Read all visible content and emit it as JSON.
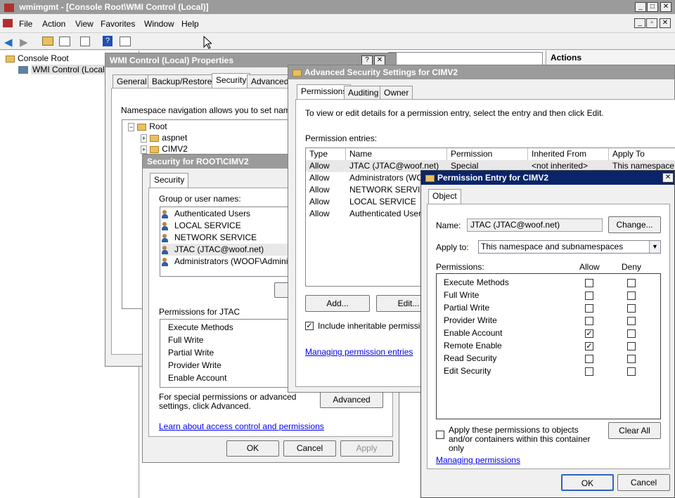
{
  "mmc": {
    "title": "wmimgmt - [Console Root\\WMI Control (Local)]",
    "menu": [
      "File",
      "Action",
      "View",
      "Favorites",
      "Window",
      "Help"
    ],
    "tree": {
      "root": "Console Root",
      "child": "WMI Control (Local)"
    },
    "actions_header": "Actions"
  },
  "props": {
    "title": "WMI Control (Local) Properties",
    "help_btn": "?",
    "close_btn": "✕",
    "tabs": [
      "General",
      "Backup/Restore",
      "Security",
      "Advanced"
    ],
    "desc": "Namespace navigation allows you to set namespac",
    "tree": [
      "Root",
      "aspnet",
      "CIMV2"
    ]
  },
  "secdlg": {
    "title": "Security for ROOT\\CIMV2",
    "tab": "Security",
    "group_label": "Group or user names:",
    "users": [
      "Authenticated Users",
      "LOCAL SERVICE",
      "NETWORK SERVICE",
      "JTAC (JTAC@woof.net)",
      "Administrators (WOOF\\Administrat"
    ],
    "perm_label": "Permissions for JTAC",
    "perms": [
      "Execute Methods",
      "Full Write",
      "Partial Write",
      "Provider Write",
      "Enable Account"
    ],
    "special": "For special permissions or advanced settings, click Advanced.",
    "advanced_btn": "Advanced",
    "learn_link": "Learn about access control and permissions",
    "ok": "OK",
    "cancel": "Cancel",
    "apply": "Apply"
  },
  "advdlg": {
    "title": "Advanced Security Settings for CIMV2",
    "tabs": [
      "Permissions",
      "Auditing",
      "Owner"
    ],
    "desc": "To view or edit details for a permission entry, select the entry and then click Edit.",
    "entries_label": "Permission entries:",
    "columns": [
      "Type",
      "Name",
      "Permission",
      "Inherited From",
      "Apply To"
    ],
    "rows": [
      {
        "type": "Allow",
        "name": "JTAC (JTAC@woof.net)",
        "perm": "Special",
        "inh": "<not inherited>",
        "apply": "This namespace or"
      },
      {
        "type": "Allow",
        "name": "Administrators (WOOF",
        "perm": "",
        "inh": "",
        "apply": ""
      },
      {
        "type": "Allow",
        "name": "NETWORK SERVICE",
        "perm": "",
        "inh": "",
        "apply": ""
      },
      {
        "type": "Allow",
        "name": "LOCAL SERVICE",
        "perm": "",
        "inh": "",
        "apply": ""
      },
      {
        "type": "Allow",
        "name": "Authenticated Users",
        "perm": "",
        "inh": "",
        "apply": ""
      }
    ],
    "add": "Add...",
    "edit": "Edit...",
    "include": "Include inheritable permissions",
    "manage_link": "Managing permission entries"
  },
  "entry": {
    "title": "Permission Entry for CIMV2",
    "close_btn": "✕",
    "tab": "Object",
    "name_label": "Name:",
    "name_value": "JTAC (JTAC@woof.net)",
    "change": "Change...",
    "apply_label": "Apply to:",
    "apply_value": "This namespace and subnamespaces",
    "perms_label": "Permissions:",
    "allow": "Allow",
    "deny": "Deny",
    "perms": [
      {
        "name": "Execute Methods",
        "allow": false,
        "deny": false
      },
      {
        "name": "Full Write",
        "allow": false,
        "deny": false
      },
      {
        "name": "Partial Write",
        "allow": false,
        "deny": false
      },
      {
        "name": "Provider Write",
        "allow": false,
        "deny": false
      },
      {
        "name": "Enable Account",
        "allow": true,
        "deny": false
      },
      {
        "name": "Remote Enable",
        "allow": true,
        "deny": false
      },
      {
        "name": "Read Security",
        "allow": false,
        "deny": false
      },
      {
        "name": "Edit Security",
        "allow": false,
        "deny": false
      }
    ],
    "apply_these": "Apply these permissions to objects and/or containers within this container only",
    "clear_all": "Clear All",
    "manage_link": "Managing permissions",
    "ok": "OK",
    "cancel": "Cancel"
  },
  "colors": {
    "title_active": "#0a246a",
    "title_inactive": "#9b9b9b",
    "link": "#0000ee",
    "check": "#000000"
  }
}
